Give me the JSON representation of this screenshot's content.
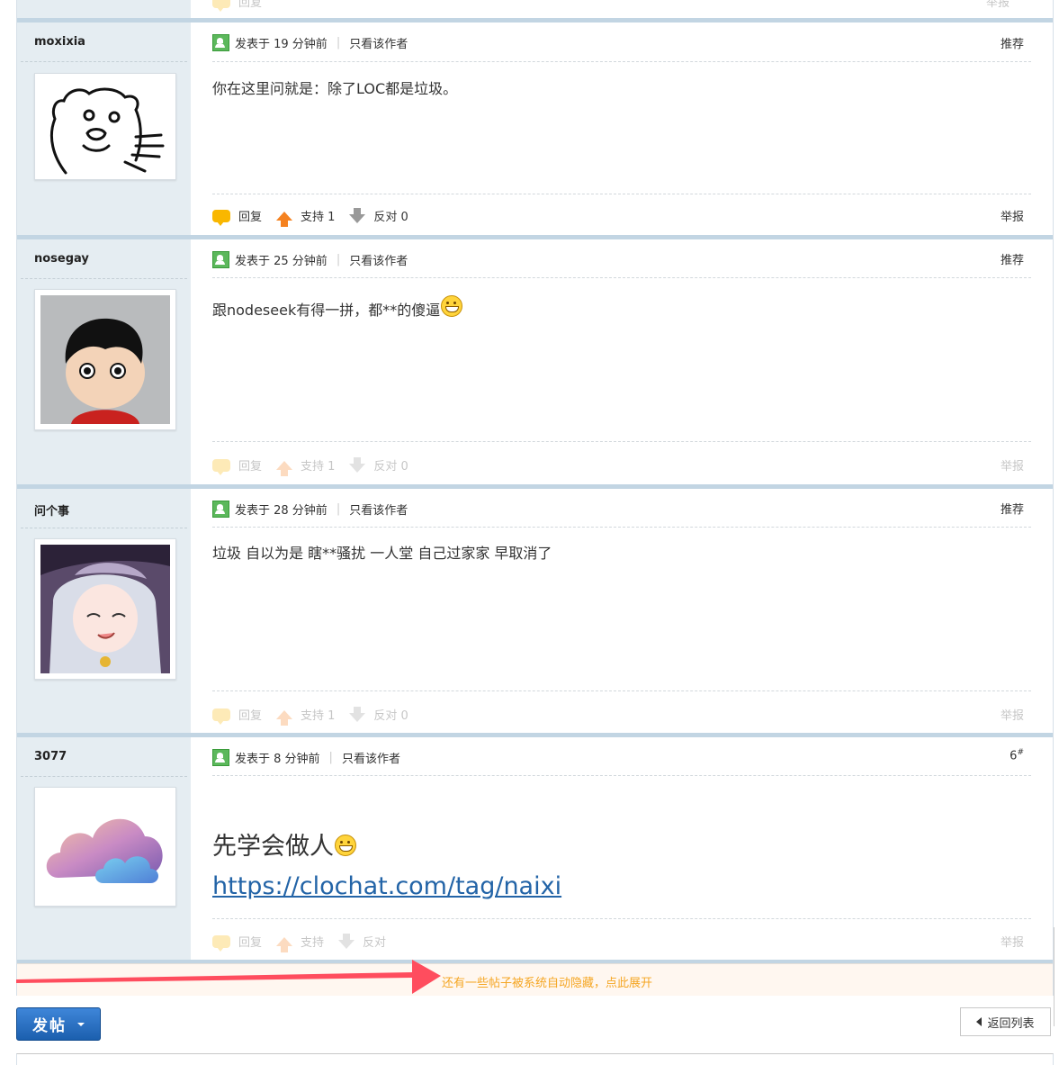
{
  "top_partial": {
    "reply": "回复",
    "report": "举报"
  },
  "posts": [
    {
      "author": "moxixia",
      "posted": "发表于 19 分钟前",
      "only_author": "只看该作者",
      "corner": "推荐",
      "content": "你在这里问就是：除了LOC都是垃圾。",
      "reply": "回复",
      "support": "支持 1",
      "oppose": "反对 0",
      "report": "举报",
      "avatar": "bear-pointing-avatar"
    },
    {
      "author": "nosegay",
      "posted": "发表于 25 分钟前",
      "only_author": "只看该作者",
      "corner": "推荐",
      "content": "跟nodeseek有得一拼，都**的傻逼",
      "reply": "回复",
      "support": "支持 1",
      "oppose": "反对 0",
      "report": "举报",
      "avatar": "cartoon-boy-avatar"
    },
    {
      "author": "问个事",
      "posted": "发表于 28 分钟前",
      "only_author": "只看该作者",
      "corner": "推荐",
      "content": "垃圾 自以为是 瞎**骚扰 一人堂 自己过家家 早取消了",
      "reply": "回复",
      "support": "支持 1",
      "oppose": "反对 0",
      "report": "举报",
      "avatar": "anime-witch-avatar"
    },
    {
      "author": "3077",
      "posted": "发表于 8 分钟前",
      "only_author": "只看该作者",
      "corner": "6",
      "corner_sup": "#",
      "content": "先学会做人",
      "link": "https://clochat.com/tag/naixi",
      "reply": "回复",
      "support": "支持",
      "oppose": "反对",
      "report": "举报",
      "avatar": "cloud-avatar"
    }
  ],
  "hidden_notice": "还有一些帖子被系统自动隐藏，点此展开",
  "post_button": "发帖",
  "back_button": "返回列表",
  "colors": {
    "arrow": "#ff4d5e",
    "notice": "#f5a623",
    "sidebar": "#e5edf2",
    "separator": "#c2d5e3"
  }
}
